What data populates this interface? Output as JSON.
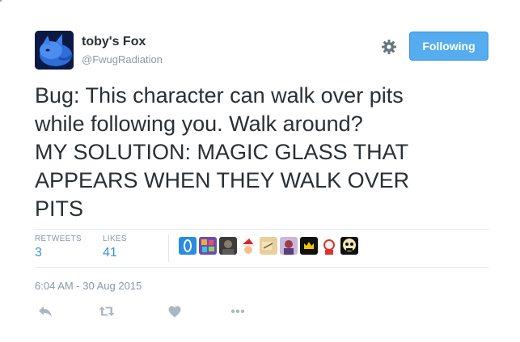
{
  "colors": {
    "accent": "#55acee",
    "name_text": "#292f33",
    "muted_text": "#8899a6",
    "stat_value": "#3b94d9",
    "divider": "#e1e8ed"
  },
  "author": {
    "display_name": "toby's Fox",
    "handle": "@FwugRadiation",
    "avatar_icon": "blue-fox-avatar"
  },
  "header": {
    "settings_icon": "gear-icon",
    "follow_button_label": "Following"
  },
  "tweet": {
    "text_lines": [
      "Bug: This character can walk over pits",
      "while following you. Walk around?",
      "MY SOLUTION: MAGIC GLASS THAT",
      "APPEARS WHEN THEY WALK OVER",
      "PITS"
    ]
  },
  "stats": {
    "retweets_label": "RETWEETS",
    "retweets_count": "3",
    "likes_label": "LIKES",
    "likes_count": "41",
    "liker_avatars": [
      "blue-oval-avatar",
      "colorful-pixel-avatar",
      "dark-portrait-avatar",
      "santa-hat-avatar",
      "tan-sketch-avatar",
      "purple-character-avatar",
      "black-yellow-crown-avatar",
      "red-white-avatar",
      "skull-face-avatar"
    ]
  },
  "timestamp": "6:04 AM - 30 Aug 2015",
  "actions": {
    "reply_icon": "reply-icon",
    "retweet_icon": "retweet-icon",
    "like_icon": "heart-icon",
    "more_icon": "more-dots-icon"
  }
}
